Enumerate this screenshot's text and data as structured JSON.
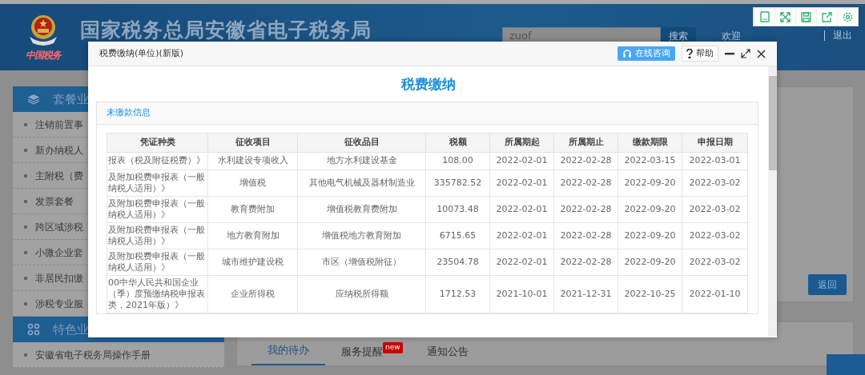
{
  "header": {
    "logo_text": "中国税务",
    "title": "国家税务总局安徽省电子税务局",
    "search": {
      "value": "zuof"
    },
    "search_button": "搜索",
    "welcome": "欢迎",
    "logout": "退出"
  },
  "sidebar": {
    "groups": [
      {
        "title": "套餐业",
        "items": [
          "注销前置事",
          "新办纳税人",
          "主附税（费",
          "发票套餐",
          "跨区域涉税",
          "小微企业套",
          "非居民扣缴",
          "涉税专业服"
        ]
      },
      {
        "title": "特色业",
        "items": [
          "安徽省电子税务局操作手册"
        ]
      }
    ]
  },
  "main": {
    "back_button": "返回",
    "tabs": [
      {
        "label": "我的待办",
        "selected": true
      },
      {
        "label": "服务提醒",
        "selected": false,
        "badge": "new"
      },
      {
        "label": "通知公告",
        "selected": false
      }
    ]
  },
  "dialog": {
    "title": "税费缴纳(单位)(新版)",
    "consult_button": "在线咨询",
    "help_button": "帮助",
    "heading": "税费缴纳",
    "panel_title": "未缴款信息",
    "table": {
      "columns": [
        "凭证种类",
        "征收项目",
        "征收品目",
        "税额",
        "所属期起",
        "所属期止",
        "缴款期限",
        "申报日期"
      ],
      "rows": [
        [
          "报表（税及附征税费）》",
          "水利建设专项收入",
          "地方水利建设基金",
          "108.00",
          "2022-02-01",
          "2022-02-28",
          "2022-03-15",
          "2022-03-01"
        ],
        [
          "及附加税费申报表（一般纳税人适用）》",
          "增值税",
          "其他电气机械及器材制造业",
          "335782.52",
          "2022-02-01",
          "2022-02-28",
          "2022-09-20",
          "2022-03-02"
        ],
        [
          "及附加税费申报表（一般纳税人适用）》",
          "教育费附加",
          "增值税教育费附加",
          "10073.48",
          "2022-02-01",
          "2022-02-28",
          "2022-09-20",
          "2022-03-02"
        ],
        [
          "及附加税费申报表（一般纳税人适用）》",
          "地方教育附加",
          "增值税地方教育附加",
          "6715.65",
          "2022-02-01",
          "2022-02-28",
          "2022-09-20",
          "2022-03-02"
        ],
        [
          "及附加税费申报表（一般纳税人适用）》",
          "城市维护建设税",
          "市区（增值税附征）",
          "23504.78",
          "2022-02-01",
          "2022-02-28",
          "2022-09-20",
          "2022-03-02"
        ],
        [
          "00中华人民共和国企业（季）度预缴纳税申报表类，2021年版）》",
          "企业所得税",
          "应纳税所得额",
          "1712.53",
          "2021-10-01",
          "2021-12-31",
          "2022-10-25",
          "2022-01-10"
        ]
      ]
    }
  }
}
